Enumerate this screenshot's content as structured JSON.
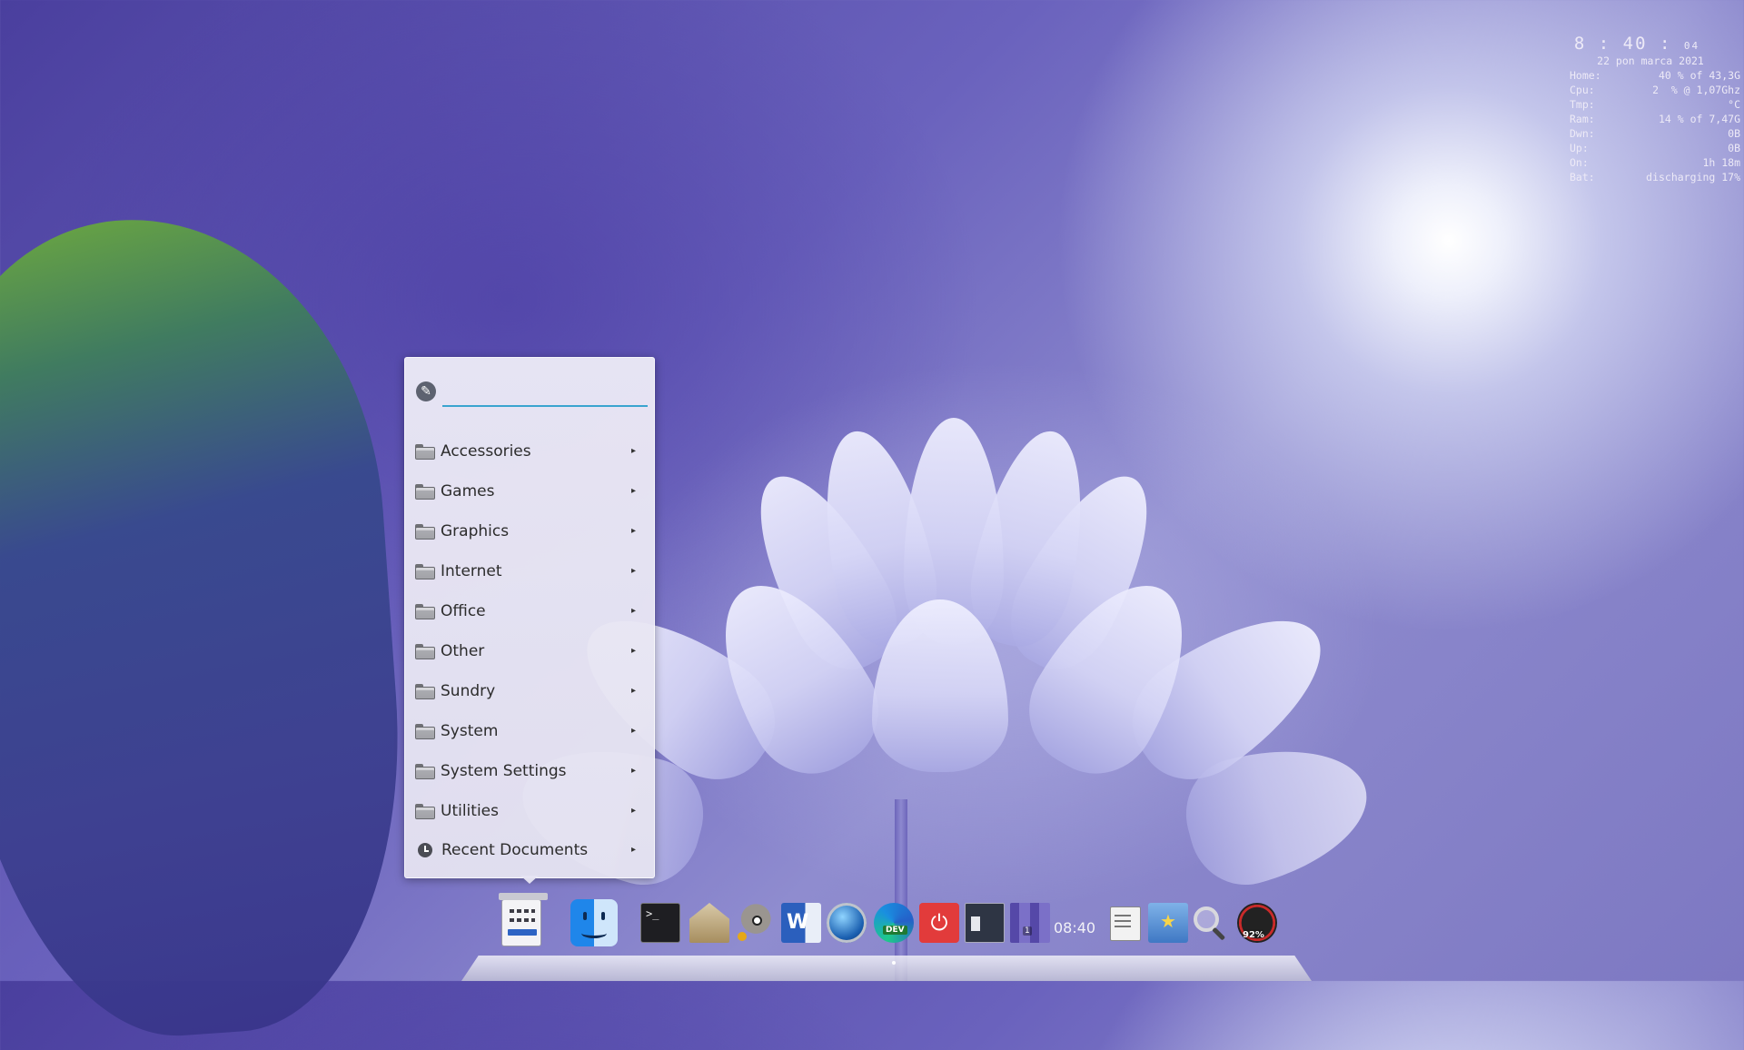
{
  "conky": {
    "time_hm": "8 : 40 :",
    "time_s": "04",
    "date": "22  pon  marca  2021",
    "rows": [
      {
        "label": "Home:",
        "value": "40 % of 43,3G"
      },
      {
        "label": "Cpu:",
        "value": "2  % @ 1,07Ghz"
      },
      {
        "label": "Tmp:",
        "value": "°C"
      },
      {
        "label": "Ram:",
        "value": "14 % of 7,47G"
      },
      {
        "label": "Dwn:",
        "value": "0B"
      },
      {
        "label": "Up:",
        "value": "0B"
      },
      {
        "label": "On:",
        "value": "1h 18m"
      },
      {
        "label": "Bat:",
        "value": "discharging 17%"
      }
    ]
  },
  "menu": {
    "search": {
      "placeholder": "",
      "value": ""
    },
    "categories": [
      {
        "label": "Accessories",
        "icon": "folder-icon"
      },
      {
        "label": "Games",
        "icon": "folder-icon"
      },
      {
        "label": "Graphics",
        "icon": "folder-icon"
      },
      {
        "label": "Internet",
        "icon": "folder-icon"
      },
      {
        "label": "Office",
        "icon": "folder-icon"
      },
      {
        "label": "Other",
        "icon": "folder-icon"
      },
      {
        "label": "Sundry",
        "icon": "folder-icon"
      },
      {
        "label": "System",
        "icon": "folder-icon"
      },
      {
        "label": "System Settings",
        "icon": "folder-icon"
      },
      {
        "label": "Utilities",
        "icon": "folder-icon"
      }
    ],
    "recent": {
      "label": "Recent Documents",
      "icon": "clock-icon"
    },
    "submenu_arrow": "▸"
  },
  "dock": {
    "clock": "08:40",
    "items": [
      {
        "name": "app-menu",
        "icon": "app-menu-icon"
      },
      {
        "name": "finder",
        "icon": "finder-icon"
      },
      {
        "name": "terminal",
        "icon": "terminal-icon",
        "glyph": ">_"
      },
      {
        "name": "installer",
        "icon": "package-installer-icon"
      },
      {
        "name": "gimp",
        "icon": "gimp-icon"
      },
      {
        "name": "word",
        "icon": "word-icon",
        "glyph": "W"
      },
      {
        "name": "web-browser",
        "icon": "web-browser-icon"
      },
      {
        "name": "edge-dev",
        "icon": "edge-dev-icon",
        "badge": "DEV"
      },
      {
        "name": "power",
        "icon": "power-icon",
        "glyph": "⏻"
      },
      {
        "name": "window-manager",
        "icon": "window-icon"
      },
      {
        "name": "workspace",
        "icon": "workspace-icon",
        "badge": "1"
      },
      {
        "name": "text-editor",
        "icon": "text-editor-icon"
      },
      {
        "name": "bookmarks",
        "icon": "bookmark-star-icon"
      },
      {
        "name": "search",
        "icon": "magnifier-icon"
      },
      {
        "name": "battery-gauge",
        "icon": "gauge-icon",
        "badge": "92%"
      }
    ]
  },
  "colors": {
    "search_underline": "#3aa4cf",
    "power_red": "#e23b3b",
    "finder_blue": "#2b8ff0",
    "word_blue": "#2b5fbd"
  }
}
